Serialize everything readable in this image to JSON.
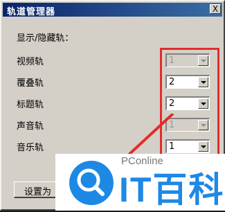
{
  "window": {
    "title": "轨道管理器",
    "close_symbol": "X"
  },
  "section_label": "显示/隐藏轨：",
  "tracks": [
    {
      "label": "视频轨",
      "value": "1",
      "enabled": false
    },
    {
      "label": "覆叠轨",
      "value": "2",
      "enabled": true
    },
    {
      "label": "标题轨",
      "value": "2",
      "enabled": true
    },
    {
      "label": "声音轨",
      "value": "1",
      "enabled": false
    },
    {
      "label": "音乐轨",
      "value": "1",
      "enabled": true
    }
  ],
  "settings_button": "设置为",
  "watermark": {
    "brand_small": "PConline",
    "brand_large": "IT百科"
  },
  "colors": {
    "highlight": "#e52b2b",
    "titlebar": "#0a246a",
    "brand": "#1e88e5"
  }
}
